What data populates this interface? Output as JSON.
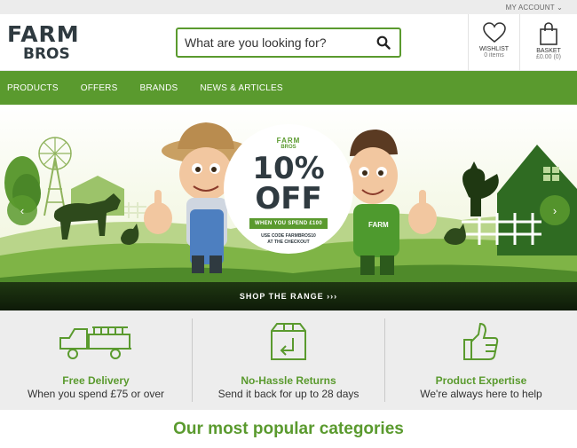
{
  "topbar": {
    "account_label": "MY ACCOUNT"
  },
  "header": {
    "logo_line1": "FARM",
    "logo_line2": "BROS",
    "search_placeholder": "What are you looking for?",
    "wishlist": {
      "label": "WISHLIST",
      "sub": "0 items"
    },
    "basket": {
      "label": "BASKET",
      "sub": "£0.00 (0)"
    }
  },
  "nav": {
    "items": [
      "PRODUCTS",
      "OFFERS",
      "BRANDS",
      "NEWS & ARTICLES"
    ]
  },
  "hero": {
    "promo_brand_1": "FARM",
    "promo_brand_2": "BROS",
    "percent": "10%",
    "off": "OFF",
    "spend": "WHEN YOU SPEND £100",
    "code_line1": "USE CODE FARMBROS10",
    "code_line2": "AT THE CHECKOUT",
    "shop_label": "SHOP THE RANGE ›››",
    "prev_arrow": "‹",
    "next_arrow": "›",
    "shirt_text": "FARM"
  },
  "features": [
    {
      "title": "Free Delivery",
      "subtitle": "When you spend £75 or over",
      "icon": "truck-icon"
    },
    {
      "title": "No-Hassle Returns",
      "subtitle": "Send it back for up to 28 days",
      "icon": "return-box-icon"
    },
    {
      "title": "Product Expertise",
      "subtitle": "We're always here to help",
      "icon": "thumbs-up-icon"
    }
  ],
  "categories": {
    "heading": "Our most popular categories"
  },
  "colors": {
    "brand_green": "#5a9a2e",
    "dark": "#2f3a40"
  }
}
